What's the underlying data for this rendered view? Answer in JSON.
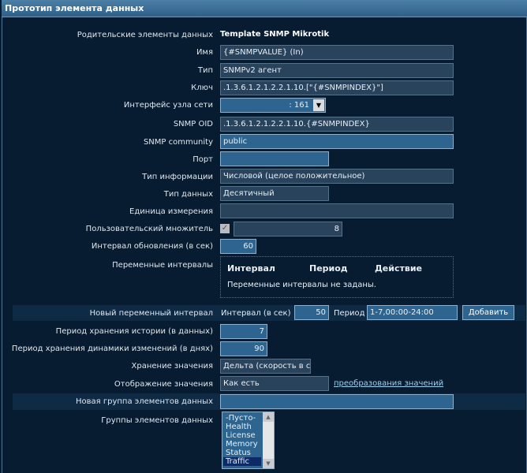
{
  "title": "Прототип элемента данных",
  "fields": {
    "parent": {
      "label": "Родительские элементы данных",
      "value": "Template SNMP Mikrotik"
    },
    "name": {
      "label": "Имя",
      "value": "{#SNMPVALUE} (In)"
    },
    "type": {
      "label": "Тип",
      "value": "SNMPv2 агент"
    },
    "key": {
      "label": "Ключ",
      "value": ".1.3.6.1.2.1.2.2.1.10.[\"{#SNMPINDEX}\"]"
    },
    "iface": {
      "label": "Интерфейс узла сети",
      "value": ": 161"
    },
    "oid": {
      "label": "SNMP OID",
      "value": ".1.3.6.1.2.1.2.2.1.10.{#SNMPINDEX}"
    },
    "community": {
      "label": "SNMP community",
      "value": "public"
    },
    "port": {
      "label": "Порт",
      "value": ""
    },
    "info": {
      "label": "Тип информации",
      "value": "Числовой (целое положительное)"
    },
    "datatype": {
      "label": "Тип данных",
      "value": "Десятичный"
    },
    "units": {
      "label": "Единица измерения",
      "value": ""
    },
    "multiplier": {
      "label": "Пользовательский множитель",
      "value": "8",
      "checked": true
    },
    "delay": {
      "label": "Интервал обновления (в сек)",
      "value": "60"
    },
    "flex": {
      "label": "Переменные интервалы",
      "cols": [
        "Интервал",
        "Период",
        "Действие"
      ],
      "empty": "Переменные интервалы не заданы."
    },
    "newflex": {
      "label": "Новый переменный интервал",
      "interval_label": "Интервал (в сек)",
      "interval": "50",
      "period_label": "Период",
      "period": "1-7,00:00-24:00",
      "add": "Добавить"
    },
    "history": {
      "label": "Период хранения истории (в данных)",
      "value": "7"
    },
    "trends": {
      "label": "Период хранения динамики изменений (в днях)",
      "value": "90"
    },
    "store": {
      "label": "Хранение значения",
      "value": "Дельта (скорость в с"
    },
    "show": {
      "label": "Отображение значения",
      "value": "Как есть",
      "link": "преобразования значений"
    },
    "newgroup": {
      "label": "Новая группа элементов данных",
      "value": ""
    },
    "groups": {
      "label": "Группы элементов данных",
      "options": [
        "-Пусто-",
        "Health",
        "License",
        "Memory",
        "Status",
        "Traffic"
      ],
      "selected": "Traffic"
    }
  }
}
